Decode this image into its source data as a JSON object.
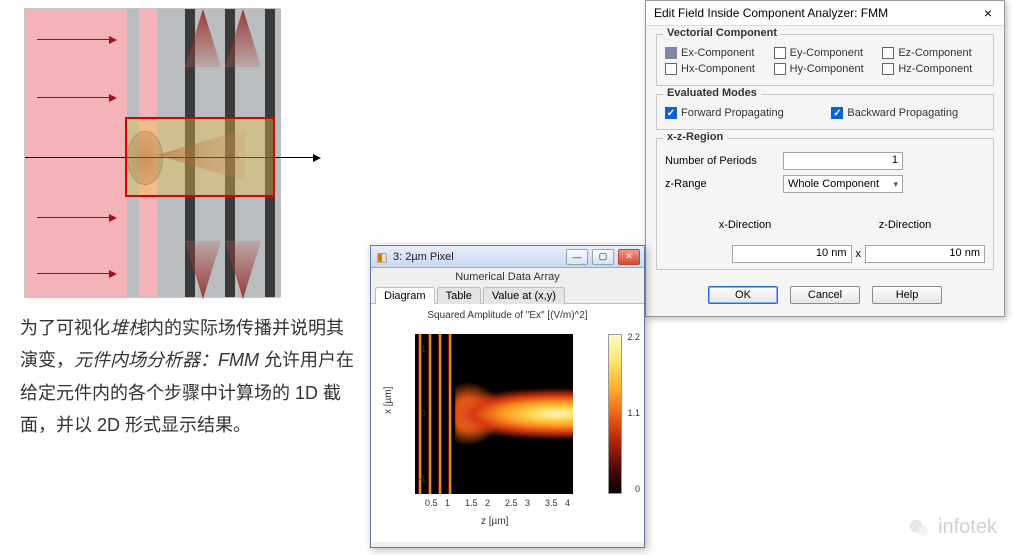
{
  "illustration": {
    "alt": "Optical stack cross-section with red propagation arrows and highlighted pixel region"
  },
  "description": {
    "text_pre": "为了可视化",
    "italic1": "堆栈",
    "text_mid1": "内的实际场传播并说明其演变，",
    "italic2": "元件内场分析器：FMM",
    "text_mid2": " 允许用户在给定元件内的各个步骤中计算场的 1D 截面，并以 2D 形式显示结果。"
  },
  "fmm_dialog": {
    "title": "Edit Field Inside Component Analyzer: FMM",
    "close": "×",
    "groups": {
      "vectorial": {
        "title": "Vectorial Component",
        "ex": "Ex-Component",
        "ey": "Ey-Component",
        "ez": "Ez-Component",
        "hx": "Hx-Component",
        "hy": "Hy-Component",
        "hz": "Hz-Component"
      },
      "modes": {
        "title": "Evaluated Modes",
        "forward": "Forward Propagating",
        "backward": "Backward Propagating"
      },
      "region": {
        "title": "x-z-Region",
        "periods_label": "Number of Periods",
        "periods_value": "1",
        "zrange_label": "z-Range",
        "zrange_value": "Whole Component",
        "xdir_header": "x-Direction",
        "zdir_header": "z-Direction",
        "xdir_value": "10 nm",
        "x_sep": "x",
        "zdir_value": "10 nm"
      }
    },
    "buttons": {
      "ok": "OK",
      "cancel": "Cancel",
      "help": "Help"
    }
  },
  "nda_window": {
    "window_title": "3: 2µm Pixel",
    "subtitle": "Numerical Data Array",
    "tabs": {
      "diagram": "Diagram",
      "table": "Table",
      "value": "Value at (x,y)"
    },
    "win_buttons": {
      "min": "—",
      "max": "▢",
      "close": "✕"
    },
    "plot_title": "Squared Amplitude of \"Ex\"  [(V/m)^2]",
    "ylabel": "x [µm]",
    "xlabel": "z [µm]"
  },
  "chart_data": {
    "type": "heatmap",
    "title": "Squared Amplitude of \"Ex\"  [(V/m)^2]",
    "xlabel": "z [µm]",
    "ylabel": "x [µm]",
    "x_ticks": [
      0.5,
      1,
      1.5,
      2,
      2.5,
      3,
      3.5,
      4
    ],
    "y_ticks": [
      -1,
      0,
      1
    ],
    "xlim": [
      0,
      4.2
    ],
    "ylim": [
      -1.4,
      1.4
    ],
    "colorbar": {
      "min": 0,
      "mid": 1.1,
      "max": 2.2,
      "ticks": [
        0,
        1.1,
        2.2
      ]
    },
    "description": "Interference fringes on left (z<0.6µm), field converges into bright central beam centered at x≈0 growing in intensity toward z≈3–4µm"
  },
  "watermark": {
    "text": "infotek"
  }
}
